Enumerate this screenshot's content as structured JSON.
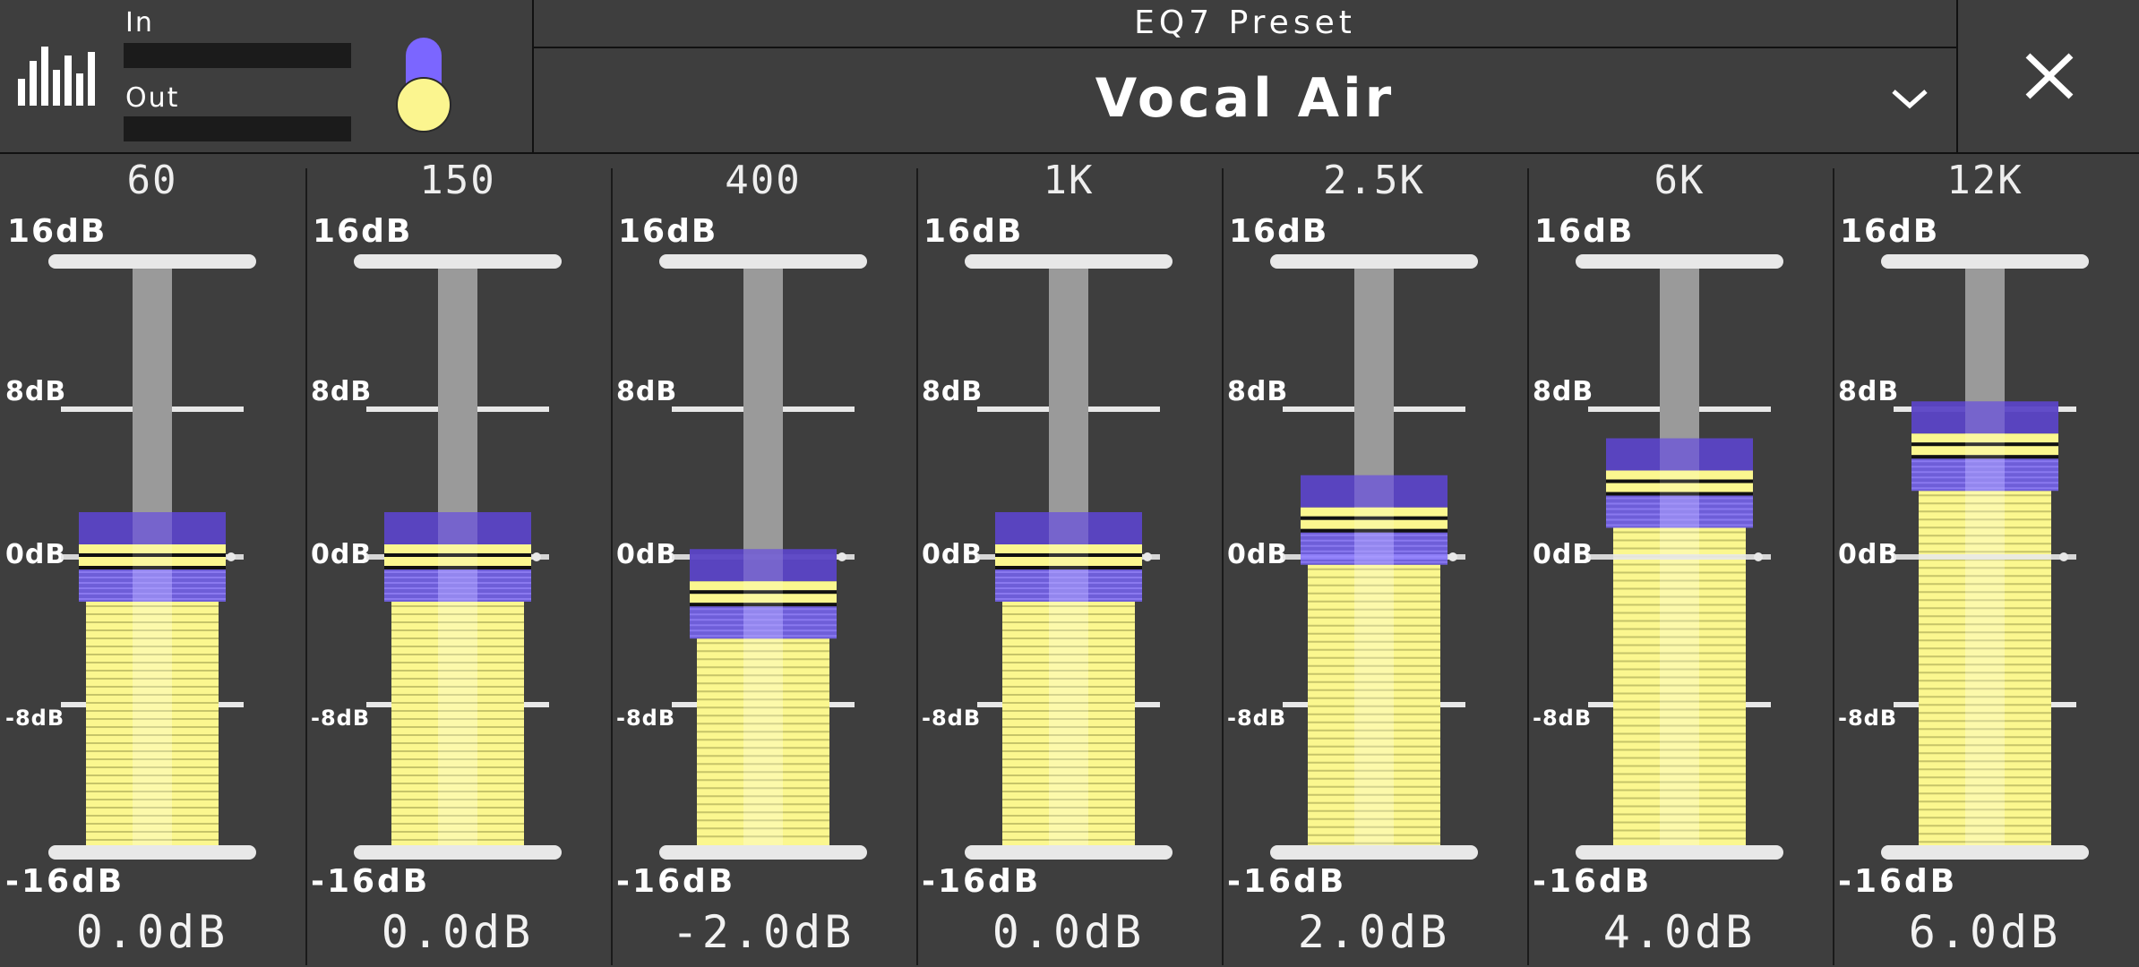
{
  "meters": {
    "in_label": "In",
    "out_label": "Out"
  },
  "preset": {
    "title": "EQ7 Preset",
    "name": "Vocal Air"
  },
  "scale": {
    "top": "16dB",
    "upper": "8dB",
    "zero": "0dB",
    "lower": "-8dB",
    "bottom": "-16dB"
  },
  "bands": [
    {
      "freq": "60",
      "value_label": "0.0dB",
      "gain_db": 0
    },
    {
      "freq": "150",
      "value_label": "0.0dB",
      "gain_db": 0
    },
    {
      "freq": "400",
      "value_label": "-2.0dB",
      "gain_db": -2
    },
    {
      "freq": "1K",
      "value_label": "0.0dB",
      "gain_db": 0
    },
    {
      "freq": "2.5K",
      "value_label": "2.0dB",
      "gain_db": 2
    },
    {
      "freq": "6K",
      "value_label": "4.0dB",
      "gain_db": 4
    },
    {
      "freq": "12K",
      "value_label": "6.0dB",
      "gain_db": 6
    }
  ],
  "colors": {
    "accent_purple": "#7b66ff",
    "fill_yellow": "#fbf78f",
    "background": "#3e3e3e"
  },
  "icons": {
    "spectrum": "spectrum-bars-icon",
    "dropdown": "chevron-down-icon",
    "close": "close-icon"
  }
}
